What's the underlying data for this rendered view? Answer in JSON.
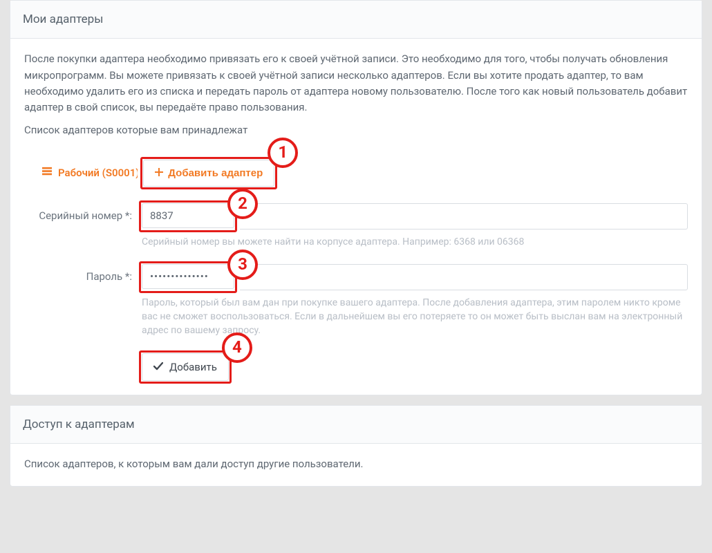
{
  "panel1": {
    "title": "Мои адаптеры",
    "intro1": "После покупки адаптера необходимо привязать его к своей учётной записи. Это необходимо для того, чтобы получать обновления микропрограмм. Вы можете привязать к своей учётной записи несколько адаптеров. Если вы хотите продать адаптер, то вам необходимо удалить его из списка и передать пароль от адаптера новому пользователю. После того как новый пользователь добавит адаптер в свой список, вы передаёте право пользования.",
    "intro2": "Список адаптеров которые вам принадлежат",
    "adapter_label": "Рабочий (S0001)",
    "add_button": "Добавить адаптер",
    "steps": {
      "s1": "1",
      "s2": "2",
      "s3": "3",
      "s4": "4"
    },
    "form": {
      "serial_label": "Серийный номер *:",
      "serial_value": "8837",
      "serial_help": "Серийный номер вы можете найти на корпусе адаптера. Например: 6368 или 06368",
      "password_label": "Пароль *:",
      "password_value": "••••••••••••••",
      "password_help": "Пароль, который был вам дан при покупке вашего адаптера. После добавления адаптера, этим паролем никто кроме вас не сможет воспользоваться. Если в дальнейшем вы его потеряете то он может быть выслан вам на электронный адрес по вашему запросу.",
      "submit": "Добавить"
    }
  },
  "panel2": {
    "title": "Доступ к адаптерам",
    "body": "Список адаптеров, к которым вам дали доступ другие пользователи."
  }
}
